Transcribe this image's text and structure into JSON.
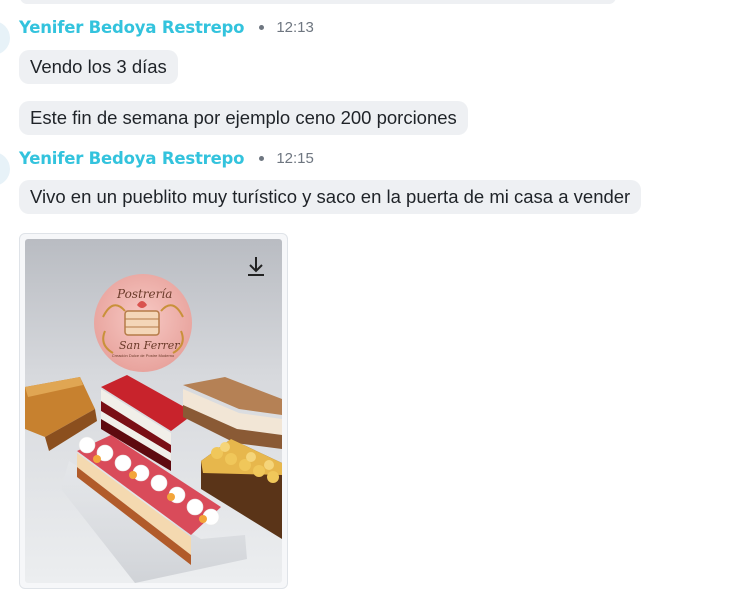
{
  "messages": [
    {
      "sender": "Yenifer Bedoya Restrepo",
      "time": "12:13",
      "bubbles": [
        "Vendo los 3 días",
        "Este fin de semana por ejemplo ceno 200 porciones"
      ]
    },
    {
      "sender": "Yenifer Bedoya Restrepo",
      "time": "12:15",
      "bubbles": [
        "Vivo en un pueblito muy turístico y saco en la puerta de mi casa a vender"
      ],
      "attachment": {
        "type": "image",
        "logo_text": {
          "line1": "Postrería",
          "line2": "San Ferrer",
          "tagline": "Creación Dulce de Postre Moderno"
        },
        "download_icon": "download-icon"
      }
    }
  ],
  "colors": {
    "sender_name": "#33c3dd",
    "bubble_bg": "#eef0f3",
    "timestamp": "#6e7680"
  }
}
